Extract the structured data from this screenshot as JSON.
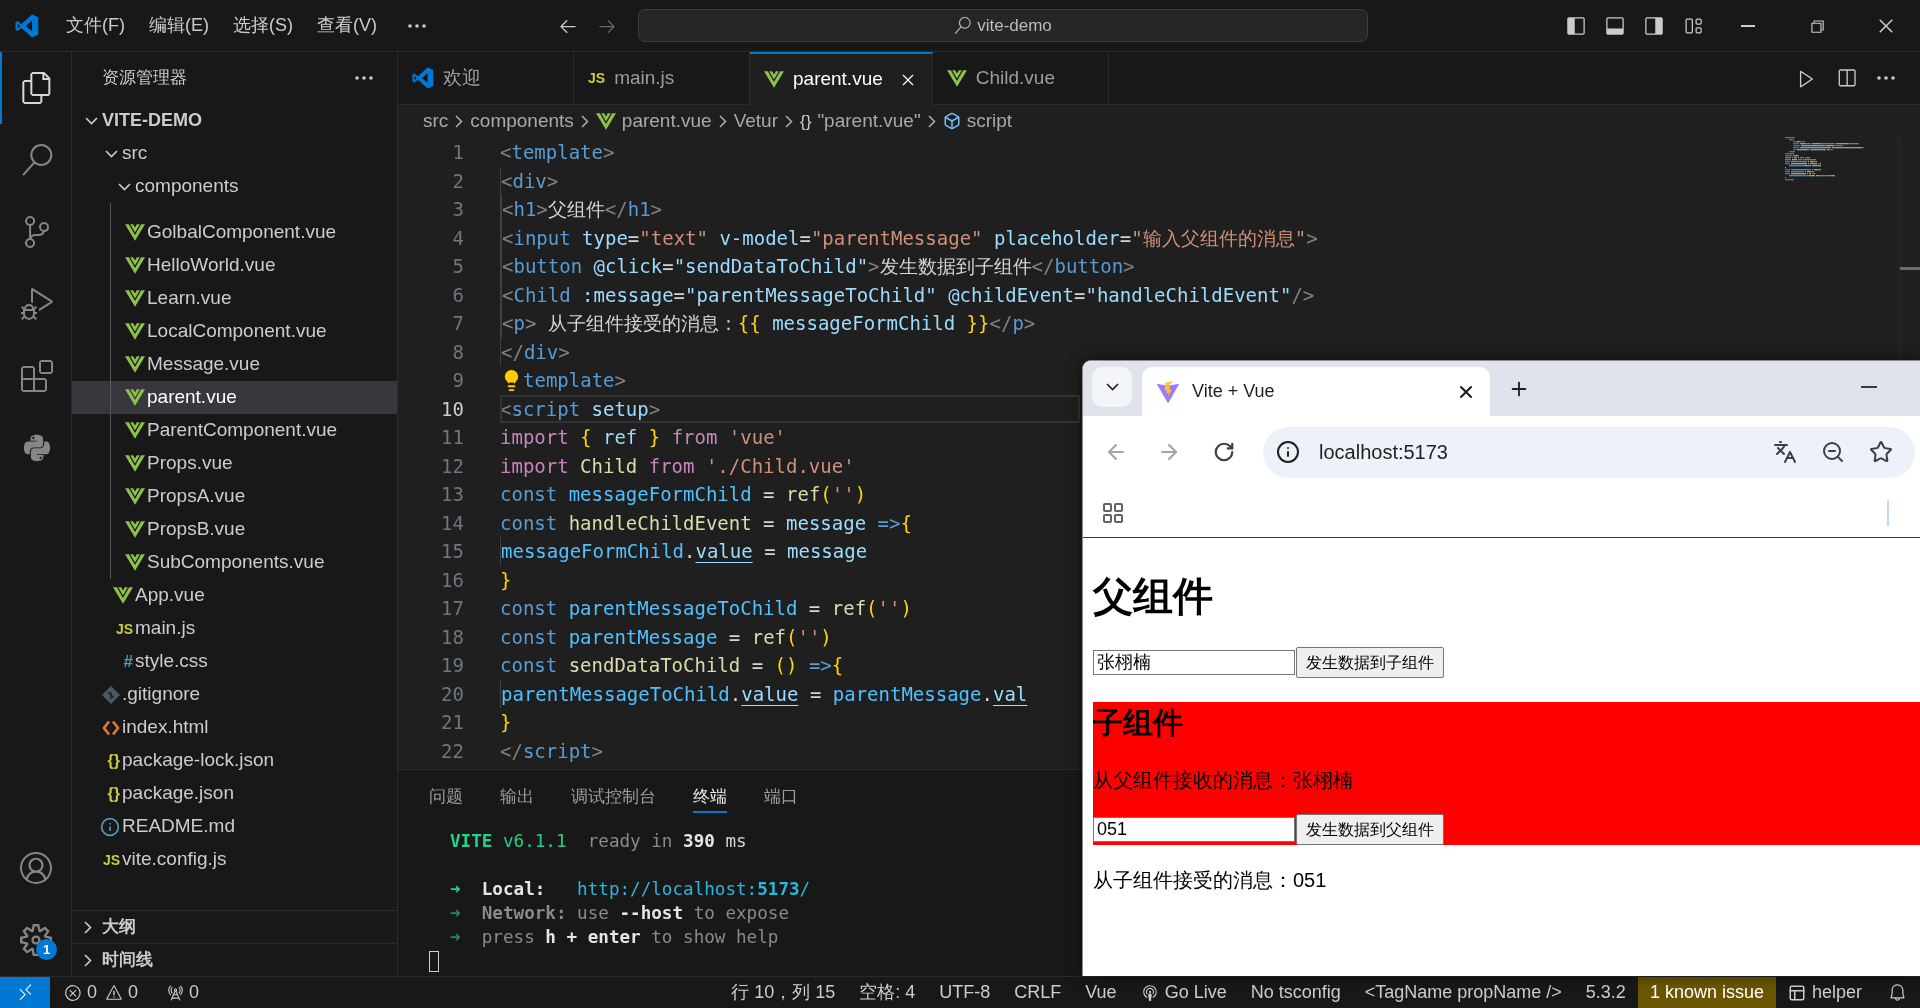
{
  "title_bar": {
    "menus": [
      "文件(F)",
      "编辑(E)",
      "选择(S)",
      "查看(V)"
    ],
    "search": "vite-demo"
  },
  "activity_bar": {
    "items": [
      {
        "kind": "explorer",
        "selected": true
      },
      {
        "kind": "search",
        "selected": false
      },
      {
        "kind": "source_control",
        "selected": false
      },
      {
        "kind": "run_debug",
        "selected": false
      },
      {
        "kind": "extensions",
        "selected": false
      },
      {
        "kind": "python",
        "selected": false
      }
    ],
    "bottom": [
      {
        "kind": "account"
      },
      {
        "kind": "settings",
        "badge": "1"
      }
    ]
  },
  "explorer": {
    "title": "资源管理器",
    "tree": [
      {
        "name": "VITE-DEMO",
        "kind": "folder",
        "expanded": true,
        "selected": false,
        "children": [
          {
            "name": "src",
            "kind": "folder",
            "expanded": true,
            "selected": false,
            "children": [
              {
                "name": "components",
                "kind": "folder",
                "expanded": true,
                "selected": false,
                "children": [
                  {
                    "name": "GolbalComponent.vue",
                    "kind": "vue",
                    "selected": false
                  },
                  {
                    "name": "HelloWorld.vue",
                    "kind": "vue",
                    "selected": false
                  },
                  {
                    "name": "Learn.vue",
                    "kind": "vue",
                    "selected": false
                  },
                  {
                    "name": "LocalComponent.vue",
                    "kind": "vue",
                    "selected": false
                  },
                  {
                    "name": "Message.vue",
                    "kind": "vue",
                    "selected": false
                  },
                  {
                    "name": "parent.vue",
                    "kind": "vue",
                    "selected": true
                  },
                  {
                    "name": "ParentComponent.vue",
                    "kind": "vue",
                    "selected": false
                  },
                  {
                    "name": "Props.vue",
                    "kind": "vue",
                    "selected": false
                  },
                  {
                    "name": "PropsA.vue",
                    "kind": "vue",
                    "selected": false
                  },
                  {
                    "name": "PropsB.vue",
                    "kind": "vue",
                    "selected": false
                  },
                  {
                    "name": "SubComponents.vue",
                    "kind": "vue",
                    "selected": false
                  }
                ]
              },
              {
                "name": "App.vue",
                "kind": "vue",
                "selected": false
              },
              {
                "name": "main.js",
                "kind": "js",
                "icon": "JS",
                "selected": false
              },
              {
                "name": "style.css",
                "kind": "css",
                "icon": "#",
                "selected": false
              }
            ]
          },
          {
            "name": ".gitignore",
            "kind": "git",
            "selected": false
          },
          {
            "name": "index.html",
            "kind": "html",
            "selected": false
          },
          {
            "name": "package-lock.json",
            "kind": "json",
            "icon": "{}",
            "selected": false
          },
          {
            "name": "package.json",
            "kind": "json",
            "icon": "{}",
            "selected": false
          },
          {
            "name": "README.md",
            "kind": "info",
            "selected": false
          },
          {
            "name": "vite.config.js",
            "kind": "js",
            "icon": "JS",
            "selected": false
          }
        ]
      }
    ],
    "sections": [
      {
        "title": "大纲",
        "expanded": false
      },
      {
        "title": "时间线",
        "expanded": false
      }
    ]
  },
  "tabs": [
    {
      "label": "欢迎",
      "kind": "vscode",
      "selected": false
    },
    {
      "label": "main.js",
      "kind": "js",
      "icon": "JS",
      "selected": false
    },
    {
      "label": "parent.vue",
      "kind": "vue",
      "selected": true
    },
    {
      "label": "Child.vue",
      "kind": "vue",
      "selected": false
    }
  ],
  "breadcrumb": [
    {
      "label": "src",
      "kind": "plain"
    },
    {
      "label": "components",
      "kind": "plain"
    },
    {
      "label": "parent.vue",
      "kind": "vue"
    },
    {
      "label": "Vetur",
      "kind": "plain"
    },
    {
      "label": "\"parent.vue\"",
      "kind": "object",
      "icon": "{}"
    },
    {
      "label": "script",
      "kind": "element"
    }
  ],
  "editor": {
    "lines": [
      {
        "number": "1",
        "current": false,
        "lightbulb": false,
        "tokens": [
          {
            "kind": "punct",
            "text": "<"
          },
          {
            "kind": "tag",
            "text": "template"
          },
          {
            "kind": "punct",
            "text": ">"
          }
        ]
      },
      {
        "number": "2",
        "current": false,
        "lightbulb": false,
        "tokens": [
          {
            "kind": "punct",
            "text": "    <"
          },
          {
            "kind": "tag",
            "text": "div"
          },
          {
            "kind": "punct",
            "text": ">"
          }
        ]
      },
      {
        "number": "3",
        "current": false,
        "lightbulb": false,
        "tokens": [
          {
            "kind": "punct",
            "text": "        <"
          },
          {
            "kind": "tag",
            "text": "h1"
          },
          {
            "kind": "punct",
            "text": ">"
          },
          {
            "kind": "text",
            "text": "父组件"
          },
          {
            "kind": "punct",
            "text": "</"
          },
          {
            "kind": "tag",
            "text": "h1"
          },
          {
            "kind": "punct",
            "text": ">"
          }
        ]
      },
      {
        "number": "4",
        "current": false,
        "lightbulb": false,
        "tokens": [
          {
            "kind": "punct",
            "text": "        <"
          },
          {
            "kind": "tag",
            "text": "input"
          },
          {
            "kind": "attr",
            "text": " type"
          },
          {
            "kind": "op",
            "text": "="
          },
          {
            "kind": "str",
            "text": "\"text\""
          },
          {
            "kind": "attr",
            "text": " v-model"
          },
          {
            "kind": "op",
            "text": "="
          },
          {
            "kind": "str",
            "text": "\"parentMessage\""
          },
          {
            "kind": "attr",
            "text": " placeholder"
          },
          {
            "kind": "op",
            "text": "="
          },
          {
            "kind": "str",
            "text": "\"输入父组件的消息\""
          },
          {
            "kind": "punct",
            "text": ">"
          }
        ]
      },
      {
        "number": "5",
        "current": false,
        "lightbulb": false,
        "tokens": [
          {
            "kind": "punct",
            "text": "        <"
          },
          {
            "kind": "tag",
            "text": "button"
          },
          {
            "kind": "attr",
            "text": " @click"
          },
          {
            "kind": "op",
            "text": "="
          },
          {
            "kind": "attr",
            "text": "\"sendDataToChild\""
          },
          {
            "kind": "punct",
            "text": ">"
          },
          {
            "kind": "text",
            "text": "发生数据到子组件"
          },
          {
            "kind": "punct",
            "text": "</"
          },
          {
            "kind": "tag",
            "text": "button"
          },
          {
            "kind": "punct",
            "text": ">"
          }
        ]
      },
      {
        "number": "6",
        "current": false,
        "lightbulb": false,
        "tokens": [
          {
            "kind": "punct",
            "text": "        <"
          },
          {
            "kind": "tag",
            "text": "Child"
          },
          {
            "kind": "attr",
            "text": " :message"
          },
          {
            "kind": "op",
            "text": "="
          },
          {
            "kind": "attr",
            "text": "\"parentMessageToChild\""
          },
          {
            "kind": "attr",
            "text": " @childEvent"
          },
          {
            "kind": "op",
            "text": "="
          },
          {
            "kind": "attr",
            "text": "\"handleChildEvent\""
          },
          {
            "kind": "punct",
            "text": "/>"
          }
        ]
      },
      {
        "number": "7",
        "current": false,
        "lightbulb": false,
        "tokens": [
          {
            "kind": "punct",
            "text": "        <"
          },
          {
            "kind": "tag",
            "text": "p"
          },
          {
            "kind": "punct",
            "text": ">"
          },
          {
            "kind": "text",
            "text": " 从子组件接受的消息："
          },
          {
            "kind": "brace",
            "text": "{{"
          },
          {
            "kind": "param",
            "text": " messageFormChild"
          },
          {
            "kind": "brace",
            "text": " }}"
          },
          {
            "kind": "punct",
            "text": "</"
          },
          {
            "kind": "tag",
            "text": "p"
          },
          {
            "kind": "punct",
            "text": ">"
          }
        ]
      },
      {
        "number": "8",
        "current": false,
        "lightbulb": false,
        "tokens": [
          {
            "kind": "punct",
            "text": "    </"
          },
          {
            "kind": "tag",
            "text": "div"
          },
          {
            "kind": "punct",
            "text": ">"
          }
        ]
      },
      {
        "number": "9",
        "current": false,
        "lightbulb": true,
        "tokens": [
          {
            "kind": "tag",
            "text": "template"
          },
          {
            "kind": "punct",
            "text": ">"
          }
        ]
      },
      {
        "number": "10",
        "current": true,
        "lightbulb": false,
        "tokens": [
          {
            "kind": "punct",
            "text": "<"
          },
          {
            "kind": "tag",
            "text": "script"
          },
          {
            "kind": "attr",
            "text": " setup"
          },
          {
            "kind": "punct",
            "text": ">"
          }
        ]
      },
      {
        "number": "11",
        "current": false,
        "lightbulb": false,
        "tokens": [
          {
            "kind": "kw",
            "text": "import"
          },
          {
            "kind": "brace",
            "text": " {"
          },
          {
            "kind": "param",
            "text": " ref"
          },
          {
            "kind": "brace",
            "text": " }"
          },
          {
            "kind": "kw",
            "text": " from"
          },
          {
            "kind": "str",
            "text": " 'vue'"
          }
        ]
      },
      {
        "number": "12",
        "current": false,
        "lightbulb": false,
        "tokens": [
          {
            "kind": "kw",
            "text": "import"
          },
          {
            "kind": "fn",
            "text": " Child"
          },
          {
            "kind": "kw",
            "text": " from"
          },
          {
            "kind": "str",
            "text": " './Child.vue'"
          }
        ]
      },
      {
        "number": "13",
        "current": false,
        "lightbulb": false,
        "tokens": [
          {
            "kind": "storage",
            "text": "const"
          },
          {
            "kind": "var",
            "text": " messageFormChild"
          },
          {
            "kind": "op",
            "text": " ="
          },
          {
            "kind": "fn",
            "text": " ref"
          },
          {
            "kind": "brace",
            "text": "("
          },
          {
            "kind": "str",
            "text": "''"
          },
          {
            "kind": "brace",
            "text": ")"
          }
        ]
      },
      {
        "number": "14",
        "current": false,
        "lightbulb": false,
        "tokens": [
          {
            "kind": "storage",
            "text": "const"
          },
          {
            "kind": "fn",
            "text": " handleChildEvent"
          },
          {
            "kind": "op",
            "text": " ="
          },
          {
            "kind": "param",
            "text": " message"
          },
          {
            "kind": "storage",
            "text": " =>"
          },
          {
            "kind": "brace",
            "text": "{"
          }
        ]
      },
      {
        "number": "15",
        "current": false,
        "lightbulb": false,
        "tokens": [
          {
            "kind": "var",
            "text": "    messageFormChild"
          },
          {
            "kind": "op",
            "text": "."
          },
          {
            "kind": "prop",
            "text": "value"
          },
          {
            "kind": "op",
            "text": " = "
          },
          {
            "kind": "param",
            "text": "message"
          }
        ]
      },
      {
        "number": "16",
        "current": false,
        "lightbulb": false,
        "tokens": [
          {
            "kind": "brace",
            "text": "}"
          }
        ]
      },
      {
        "number": "17",
        "current": false,
        "lightbulb": false,
        "tokens": [
          {
            "kind": "storage",
            "text": "const"
          },
          {
            "kind": "var",
            "text": " parentMessageToChild"
          },
          {
            "kind": "op",
            "text": " ="
          },
          {
            "kind": "fn",
            "text": " ref"
          },
          {
            "kind": "brace",
            "text": "("
          },
          {
            "kind": "str",
            "text": "''"
          },
          {
            "kind": "brace",
            "text": ")"
          }
        ]
      },
      {
        "number": "18",
        "current": false,
        "lightbulb": false,
        "tokens": [
          {
            "kind": "storage",
            "text": "const"
          },
          {
            "kind": "var",
            "text": " parentMessage"
          },
          {
            "kind": "op",
            "text": " ="
          },
          {
            "kind": "fn",
            "text": " ref"
          },
          {
            "kind": "brace",
            "text": "("
          },
          {
            "kind": "str",
            "text": "''"
          },
          {
            "kind": "brace",
            "text": ")"
          }
        ]
      },
      {
        "number": "19",
        "current": false,
        "lightbulb": false,
        "tokens": [
          {
            "kind": "storage",
            "text": "const"
          },
          {
            "kind": "fn",
            "text": " sendDataToChild"
          },
          {
            "kind": "op",
            "text": " ="
          },
          {
            "kind": "brace",
            "text": " ()"
          },
          {
            "kind": "storage",
            "text": " =>"
          },
          {
            "kind": "brace",
            "text": "{"
          }
        ]
      },
      {
        "number": "20",
        "current": false,
        "lightbulb": false,
        "tokens": [
          {
            "kind": "var",
            "text": "    parentMessageToChild"
          },
          {
            "kind": "op",
            "text": "."
          },
          {
            "kind": "prop",
            "text": "value"
          },
          {
            "kind": "op",
            "text": " = "
          },
          {
            "kind": "var",
            "text": "parentMessage"
          },
          {
            "kind": "op",
            "text": "."
          },
          {
            "kind": "prop",
            "text": "val"
          }
        ]
      },
      {
        "number": "21",
        "current": false,
        "lightbulb": false,
        "tokens": [
          {
            "kind": "brace",
            "text": "}"
          }
        ]
      },
      {
        "number": "22",
        "current": false,
        "lightbulb": false,
        "tokens": [
          {
            "kind": "punct",
            "text": "</"
          },
          {
            "kind": "tag",
            "text": "script"
          },
          {
            "kind": "punct",
            "text": ">"
          }
        ]
      }
    ]
  },
  "panel": {
    "tabs": [
      {
        "label": "问题",
        "selected": false
      },
      {
        "label": "输出",
        "selected": false
      },
      {
        "label": "调试控制台",
        "selected": false
      },
      {
        "label": "终端",
        "selected": true
      },
      {
        "label": "端口",
        "selected": false
      }
    ],
    "terminal": [
      {
        "kind": "text",
        "tokens": [
          {
            "kind": "brand",
            "text": "VITE"
          },
          {
            "kind": "version",
            "text": " v6.1.1"
          },
          {
            "kind": "dim",
            "text": "  ready in "
          },
          {
            "kind": "bold",
            "text": "390"
          },
          {
            "kind": "plain",
            "text": " ms"
          }
        ]
      },
      {
        "kind": "blank"
      },
      {
        "kind": "text",
        "tokens": [
          {
            "kind": "arrow",
            "text": "➜"
          },
          {
            "kind": "bold",
            "text": "  Local:"
          },
          {
            "kind": "link",
            "text": "   http://localhost:"
          },
          {
            "kind": "linkbold",
            "text": "5173"
          },
          {
            "kind": "link",
            "text": "/"
          }
        ]
      },
      {
        "kind": "text",
        "tokens": [
          {
            "kind": "arrowdim",
            "text": "➜"
          },
          {
            "kind": "dimbold",
            "text": "  Network:"
          },
          {
            "kind": "dim",
            "text": " use "
          },
          {
            "kind": "bold",
            "text": "--host"
          },
          {
            "kind": "dim",
            "text": " to expose"
          }
        ]
      },
      {
        "kind": "text",
        "tokens": [
          {
            "kind": "arrowdim",
            "text": "➜"
          },
          {
            "kind": "dim",
            "text": "  press "
          },
          {
            "kind": "bold",
            "text": "h + enter"
          },
          {
            "kind": "dim",
            "text": " to show help"
          }
        ]
      },
      {
        "kind": "cursor"
      }
    ]
  },
  "status_bar": {
    "problems": {
      "errors": "0",
      "warnings": "0"
    },
    "ports": "0",
    "items": [
      {
        "kind": "text",
        "text": "行 10，列 15"
      },
      {
        "kind": "text",
        "text": "空格: 4"
      },
      {
        "kind": "text",
        "text": "UTF-8"
      },
      {
        "kind": "text",
        "text": "CRLF"
      },
      {
        "kind": "text",
        "text": "Vue"
      },
      {
        "kind": "golive",
        "text": "Go Live"
      },
      {
        "kind": "text",
        "text": "No tsconfig"
      },
      {
        "kind": "text",
        "text": "<TagName propName />"
      },
      {
        "kind": "text",
        "text": "5.3.2"
      },
      {
        "kind": "warning",
        "text": "1 known issue"
      },
      {
        "kind": "helper",
        "text": "helper"
      }
    ]
  },
  "browser": {
    "tab_title": "Vite + Vue",
    "url": "localhost:5173",
    "page": {
      "heading": "父组件",
      "input": {
        "value": "张栩楠"
      },
      "button": "发生数据到子组件",
      "child": {
        "heading": "子组件",
        "message": "从父组件接收的消息：张栩楠",
        "input": {
          "value": "051"
        },
        "button": "发生数据到父组件"
      },
      "received": "从子组件接受的消息：051"
    }
  }
}
